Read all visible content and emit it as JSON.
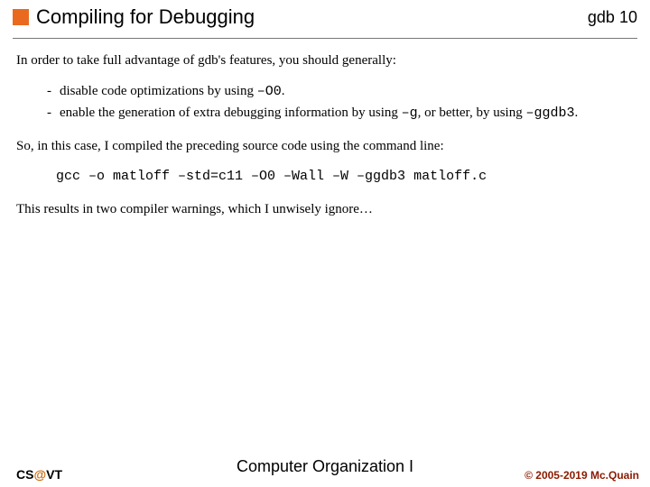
{
  "header": {
    "title": "Compiling for Debugging",
    "topic": "gdb",
    "page": "10",
    "square_color": "#E96A1F"
  },
  "body": {
    "intro": "In order to take full advantage of gdb's features, you should generally:",
    "bullet1_a": "disable code optimizations by using ",
    "bullet1_code": "–O0",
    "bullet1_b": ".",
    "bullet2_a": "enable the generation of extra debugging information by using ",
    "bullet2_code1": "–g",
    "bullet2_b": ", or better, by using ",
    "bullet2_code2": "–ggdb3",
    "bullet2_c": ".",
    "line2": "So, in this case, I compiled the preceding source code using the command line:",
    "cmd": "gcc –o matloff –std=c11 –O0 –Wall –W –ggdb3 matloff.c",
    "line3": "This results in two compiler warnings, which I unwisely ignore…"
  },
  "footer": {
    "left_a": "CS",
    "left_at": "@",
    "left_b": "VT",
    "center": "Computer Organization I",
    "right": "© 2005-2019 Mc.Quain"
  }
}
